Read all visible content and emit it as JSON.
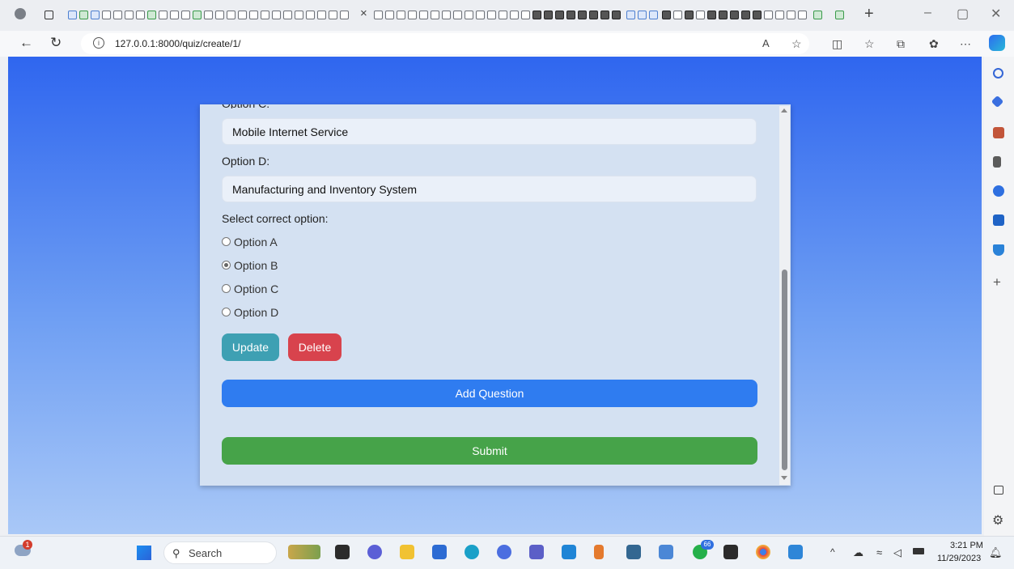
{
  "browser": {
    "active_tab_close": "×",
    "new_tab": "+",
    "window_controls": {
      "minimize": "–",
      "restore": "▢",
      "close": "✕"
    },
    "url": "127.0.0.1:8000/quiz/create/1/",
    "nav_icons": [
      "back-icon",
      "refresh-icon",
      "info-icon",
      "read-aloud-icon",
      "favorite-icon",
      "split-screen-icon",
      "favorites-icon",
      "collections-icon",
      "extensions-icon",
      "more-icon",
      "copilot-icon"
    ]
  },
  "form": {
    "option_c_label": "Option C:",
    "option_c_value": "Mobile Internet Service",
    "option_d_label": "Option D:",
    "option_d_value": "Manufacturing and Inventory System",
    "select_label": "Select correct option:",
    "radios": [
      {
        "label": "Option A",
        "checked": false
      },
      {
        "label": "Option B",
        "checked": true
      },
      {
        "label": "Option C",
        "checked": false
      },
      {
        "label": "Option D",
        "checked": false
      }
    ],
    "update_button": "Update",
    "delete_button": "Delete",
    "add_question_button": "Add Question",
    "submit_button": "Submit"
  },
  "colors": {
    "update": "#3ea0b3",
    "delete": "#d8434d",
    "add_question": "#2f7cf0",
    "submit": "#46a349"
  },
  "taskbar": {
    "notification_badge": "1",
    "search_label": "Search",
    "whatsapp_badge": "66",
    "time": "3:21 PM",
    "date": "11/29/2023"
  }
}
